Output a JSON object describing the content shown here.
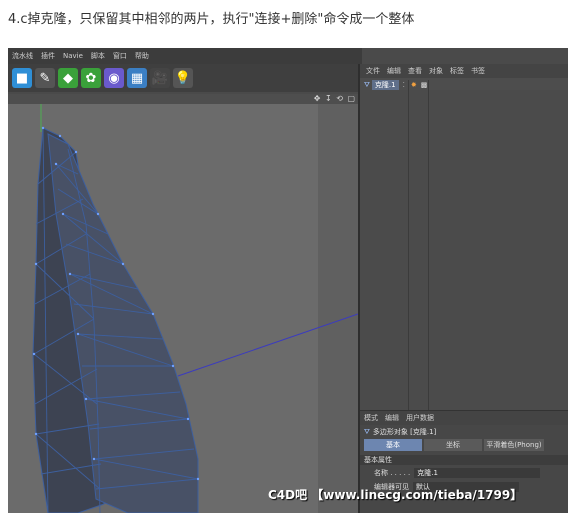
{
  "caption": "4.c掉克隆，只保留其中相邻的两片，执行\"连接+删除\"命令成一个整体",
  "menu": [
    "流水线",
    "插件",
    "Navie",
    "脚本",
    "窗口",
    "帮助"
  ],
  "toolbar_icons": [
    "cube-icon",
    "pen-icon",
    "subdivision-icon",
    "array-icon",
    "deformer-icon",
    "floor-icon",
    "camera-icon",
    "light-icon"
  ],
  "object_manager": {
    "tabs": [
      "文件",
      "编辑",
      "查看",
      "对象",
      "标签",
      "书签"
    ],
    "object_name": "克隆.1"
  },
  "attributes": {
    "tabs": [
      "模式",
      "编辑",
      "用户数据"
    ],
    "title": "多边形对象 [克隆.1]",
    "buttons": [
      "基本",
      "坐标",
      "平滑着色(Phong)"
    ],
    "section": "基本属性",
    "name_label": "名称 . . . . .",
    "name_value": "克隆.1",
    "row2_label": "编辑器可见",
    "row2_value": "默认"
  },
  "watermark": "C4D吧 【www.linecg.com/tieba/1799】",
  "colors": {
    "viewport": "#6b6b6b",
    "wire": "#3d5f9e",
    "selected": "#6d86b0"
  }
}
